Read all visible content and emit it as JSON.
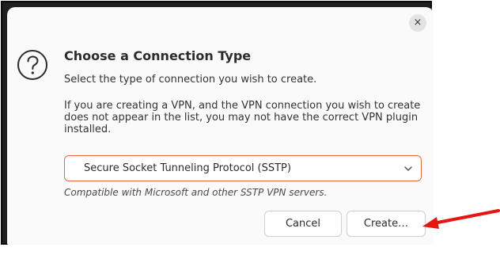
{
  "dialog": {
    "close_glyph": "×",
    "title": "Choose a Connection Type",
    "subtitle": "Select the type of connection you wish to create.",
    "info_lines": [
      "If you are creating a VPN, and the VPN connection you wish to create",
      "does not appear in the list, you may not have the correct VPN plugin",
      "installed."
    ],
    "connection_type": {
      "selected": "Secure Socket Tunneling Protocol (SSTP)"
    },
    "hint": "Compatible with Microsoft and other SSTP VPN servers.",
    "buttons": {
      "cancel": "Cancel",
      "create": "Create…"
    }
  },
  "icons": {
    "question": "question-circle-icon",
    "chevron": "chevron-down-icon",
    "close": "close-icon",
    "annotation": "red-arrow-annotation"
  },
  "colors": {
    "focus_border": "#e06b3a",
    "arrow": "#e8140f",
    "dialog_bg": "#fafafa",
    "frame": "#1f1f1f"
  }
}
